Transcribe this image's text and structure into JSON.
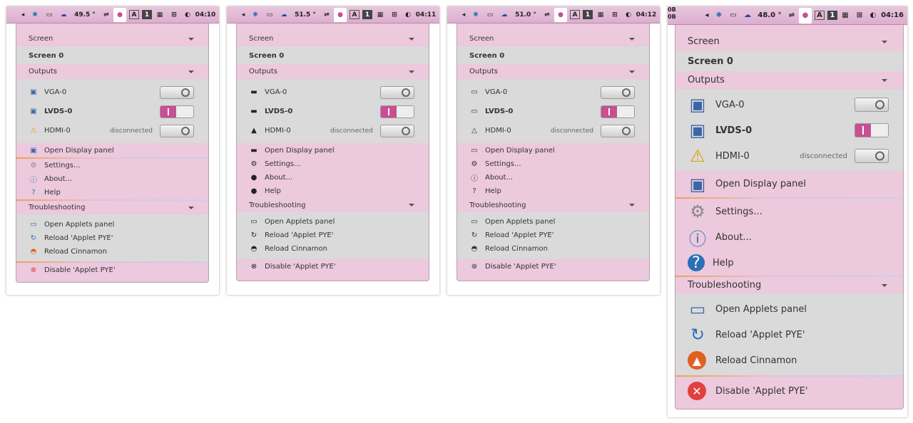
{
  "shots": [
    {
      "temp": "49.5 °",
      "clock": "04:10",
      "style": "color"
    },
    {
      "temp": "51.5 °",
      "clock": "04:11",
      "style": "mono"
    },
    {
      "temp": "51.0 °",
      "clock": "04:12",
      "style": "outline"
    },
    {
      "temp": "48.0 °",
      "clock": "04:16",
      "style": "color"
    }
  ],
  "tray": {
    "keyboard": "A",
    "workspace": "1",
    "corner_text": "0B\n0B"
  },
  "menu": {
    "screen_header": "Screen",
    "screen_item": "Screen 0",
    "outputs_header": "Outputs",
    "outputs": [
      {
        "label": "VGA-0",
        "status": "",
        "on": false,
        "icon": "monitor-icon"
      },
      {
        "label": "LVDS-0",
        "status": "",
        "on": true,
        "icon": "monitor-icon"
      },
      {
        "label": "HDMI-0",
        "status": "disconnected",
        "on": false,
        "icon": "warning-icon"
      }
    ],
    "open_display": "Open Display panel",
    "settings": "Settings...",
    "about": "About...",
    "help": "Help",
    "trouble_header": "Troubleshooting",
    "open_applets": "Open Applets panel",
    "reload_applet": "Reload 'Applet PYE'",
    "reload_cinnamon": "Reload Cinnamon",
    "disable": "Disable 'Applet PYE'"
  },
  "colors": {
    "accent": "#c84f92",
    "menu_bg": "#ecc9dc",
    "body_bg": "#dadada"
  }
}
